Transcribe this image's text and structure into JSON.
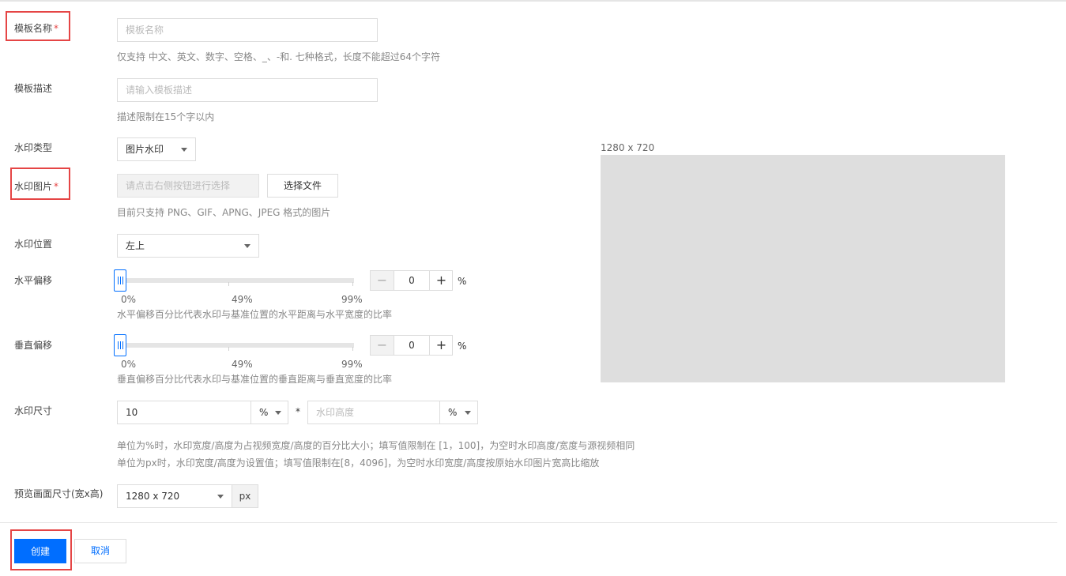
{
  "form": {
    "template_name": {
      "label": "模板名称",
      "required_mark": "*",
      "placeholder": "模板名称",
      "hint": "仅支持 中文、英文、数字、空格、_、-和. 七种格式，长度不能超过64个字符"
    },
    "template_desc": {
      "label": "模板描述",
      "placeholder": "请输入模板描述",
      "hint": "描述限制在15个字以内"
    },
    "watermark_type": {
      "label": "水印类型",
      "value": "图片水印"
    },
    "watermark_image": {
      "label": "水印图片",
      "required_mark": "*",
      "placeholder": "请点击右侧按钮进行选择",
      "button": "选择文件",
      "hint": "目前只支持 PNG、GIF、APNG、JPEG 格式的图片"
    },
    "watermark_position": {
      "label": "水印位置",
      "value": "左上"
    },
    "horizontal_offset": {
      "label": "水平偏移",
      "value": 0,
      "display_value": "0",
      "unit": "%",
      "ticks": [
        "0%",
        "49%",
        "99%"
      ],
      "hint": "水平偏移百分比代表水印与基准位置的水平距离与水平宽度的比率"
    },
    "vertical_offset": {
      "label": "垂直偏移",
      "value": 0,
      "display_value": "0",
      "unit": "%",
      "ticks": [
        "0%",
        "49%",
        "99%"
      ],
      "hint": "垂直偏移百分比代表水印与基准位置的垂直距离与垂直宽度的比率"
    },
    "watermark_size": {
      "label": "水印尺寸",
      "width_value": "10",
      "width_unit": "%",
      "separator": "*",
      "height_placeholder": "水印高度",
      "height_unit": "%",
      "hint_line1": "单位为%时，水印宽度/高度为占视频宽度/高度的百分比大小；填写值限制在 [1，100]，为空时水印高度/宽度与源视频相同",
      "hint_line2": "单位为px时，水印宽度/高度为设置值；填写值限制在[8，4096]，为空时水印宽度/高度按原始水印图片宽高比缩放"
    },
    "preview_size": {
      "label": "预览画面尺寸(宽x高)",
      "value": "1280 x 720",
      "unit": "px"
    }
  },
  "preview": {
    "size_label": "1280 x 720",
    "canvas_color": "#dedede"
  },
  "actions": {
    "create": "创建",
    "cancel": "取消"
  },
  "colors": {
    "primary": "#006eff",
    "highlight_border": "#e54545",
    "required": "#e54545"
  },
  "icons": {
    "dropdown": "chevron-down-icon",
    "minus": "minus-icon",
    "plus": "plus-icon",
    "slider_grip": "slider-grip-icon"
  }
}
